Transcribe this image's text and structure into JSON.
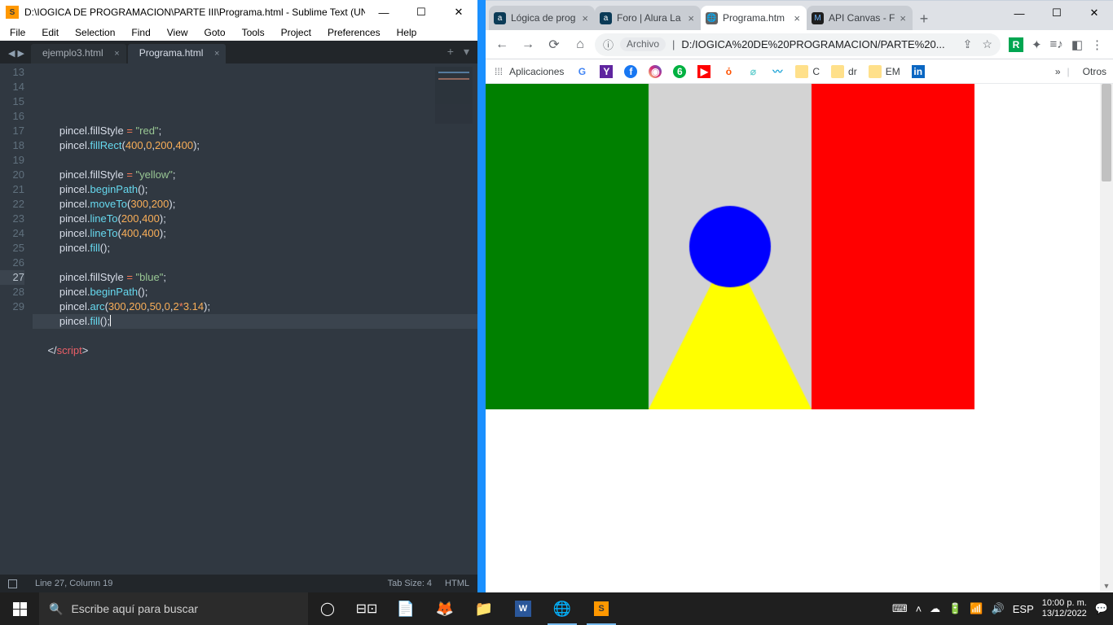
{
  "sublime": {
    "window_title": "D:\\IOGICA DE PROGRAMACION\\PARTE III\\Programa.html - Sublime Text (UNR...",
    "menu": [
      "File",
      "Edit",
      "Selection",
      "Find",
      "View",
      "Goto",
      "Tools",
      "Project",
      "Preferences",
      "Help"
    ],
    "tabs": [
      {
        "name": "ejemplo3.html",
        "active": false
      },
      {
        "name": "Programa.html",
        "active": true
      }
    ],
    "gutter_start": 13,
    "gutter_end": 29,
    "active_line": 27,
    "status_left": "Line 27, Column 19",
    "status_tab": "Tab Size: 4",
    "status_lang": "HTML"
  },
  "chrome": {
    "tabs": [
      {
        "label": "Lógica de prog",
        "active": false,
        "fav_bg": "#0b3b57",
        "fav_txt": "a",
        "fav_color": "#fff"
      },
      {
        "label": "Foro | Alura La",
        "active": false,
        "fav_bg": "#0b3b57",
        "fav_txt": "a",
        "fav_color": "#fff"
      },
      {
        "label": "Programa.htm",
        "active": true,
        "fav_bg": "#616161",
        "fav_txt": "🌐",
        "fav_color": "#fff"
      },
      {
        "label": "API Canvas - F",
        "active": false,
        "fav_bg": "#1e1e1e",
        "fav_txt": "M",
        "fav_color": "#6fb7ff"
      }
    ],
    "omnibox_chip": "Archivo",
    "omnibox_url": "D:/IOGICA%20DE%20PROGRAMACION/PARTE%20...",
    "bookmarks_label": "Aplicaciones",
    "bookmarks": [
      {
        "glyph": "G",
        "color": "#4285f4",
        "label": ""
      },
      {
        "glyph": "Y",
        "bg": "#5f259f",
        "color": "#fff",
        "label": ""
      },
      {
        "glyph": "f",
        "bg": "#1877f2",
        "color": "#fff",
        "label": "",
        "round": true
      },
      {
        "glyph": "◉",
        "bg": "linear-gradient(45deg,#feda75,#d62976,#4f5bd5)",
        "color": "#fff",
        "label": "",
        "round": true
      },
      {
        "glyph": "6",
        "bg": "#00b140",
        "color": "#fff",
        "label": "",
        "round": true
      },
      {
        "glyph": "▶",
        "bg": "#ff0000",
        "color": "#fff",
        "label": ""
      },
      {
        "glyph": "ỏ",
        "color": "#ff5100",
        "label": ""
      },
      {
        "glyph": "⌀",
        "color": "#6dd1d1",
        "label": ""
      },
      {
        "glyph": "〰",
        "color": "#1ba2d6",
        "label": ""
      },
      {
        "glyph": "",
        "folder": true,
        "label": "C"
      },
      {
        "glyph": "",
        "folder": true,
        "label": "dr"
      },
      {
        "glyph": "",
        "folder": true,
        "label": "EM"
      },
      {
        "glyph": "in",
        "bg": "#0a66c2",
        "color": "#fff",
        "label": ""
      }
    ],
    "bookmarks_overflow": "»",
    "bookmarks_right_label": "Otros"
  },
  "taskbar": {
    "search_placeholder": "Escribe aquí para buscar",
    "lang": "ESP",
    "time": "10:00 p. m.",
    "date": "13/12/2022"
  }
}
